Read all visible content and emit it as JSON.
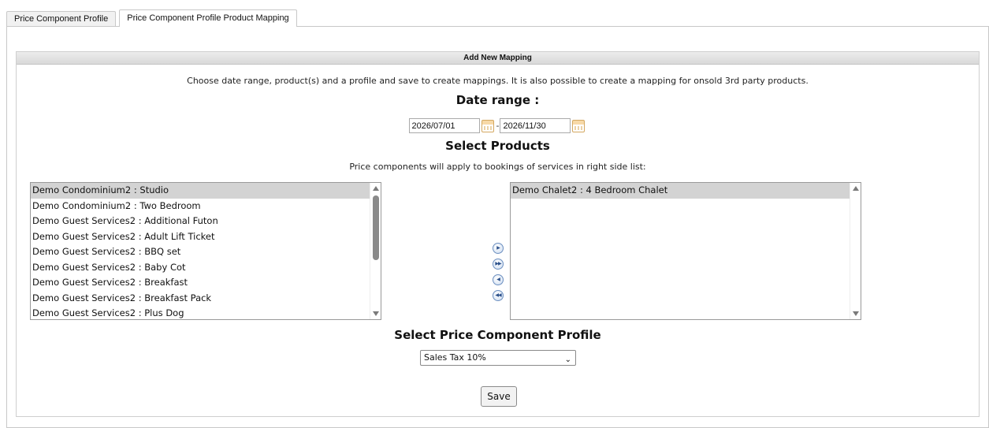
{
  "tabs": [
    {
      "label": "Price Component Profile",
      "active": false
    },
    {
      "label": "Price Component Profile Product Mapping",
      "active": true
    }
  ],
  "panel": {
    "header": "Add New Mapping",
    "intro": "Choose date range, product(s) and a profile and save to create mappings. It is also possible to create a mapping for onsold 3rd party products."
  },
  "date_range": {
    "heading": "Date range :",
    "start": "2026/07/01",
    "separator": "-",
    "end": "2026/11/30"
  },
  "products": {
    "heading": "Select Products",
    "subtext": "Price components will apply to bookings of services in right side list:",
    "available": [
      "Demo Condominium2 : Studio",
      "Demo Condominium2 : Two Bedroom",
      "Demo Guest Services2 : Additional Futon",
      "Demo Guest Services2 : Adult Lift Ticket",
      "Demo Guest Services2 : BBQ set",
      "Demo Guest Services2 : Baby Cot",
      "Demo Guest Services2 : Breakfast",
      "Demo Guest Services2 : Breakfast Pack",
      "Demo Guest Services2 : Plus Dog"
    ],
    "available_selected_index": 0,
    "selected": [
      "Demo Chalet2 : 4 Bedroom Chalet"
    ],
    "move_buttons": {
      "move_right": "▶",
      "move_all_right": "▶▶",
      "move_left": "◀",
      "move_all_left": "◀◀"
    }
  },
  "profile": {
    "heading": "Select Price Component Profile",
    "selected_value": "Sales Tax 10%"
  },
  "actions": {
    "save_label": "Save"
  },
  "colors": {
    "selected_row": "#d3d3d3",
    "header_bg": "#dcdcdc",
    "calendar_icon": "#f7d9a8"
  }
}
